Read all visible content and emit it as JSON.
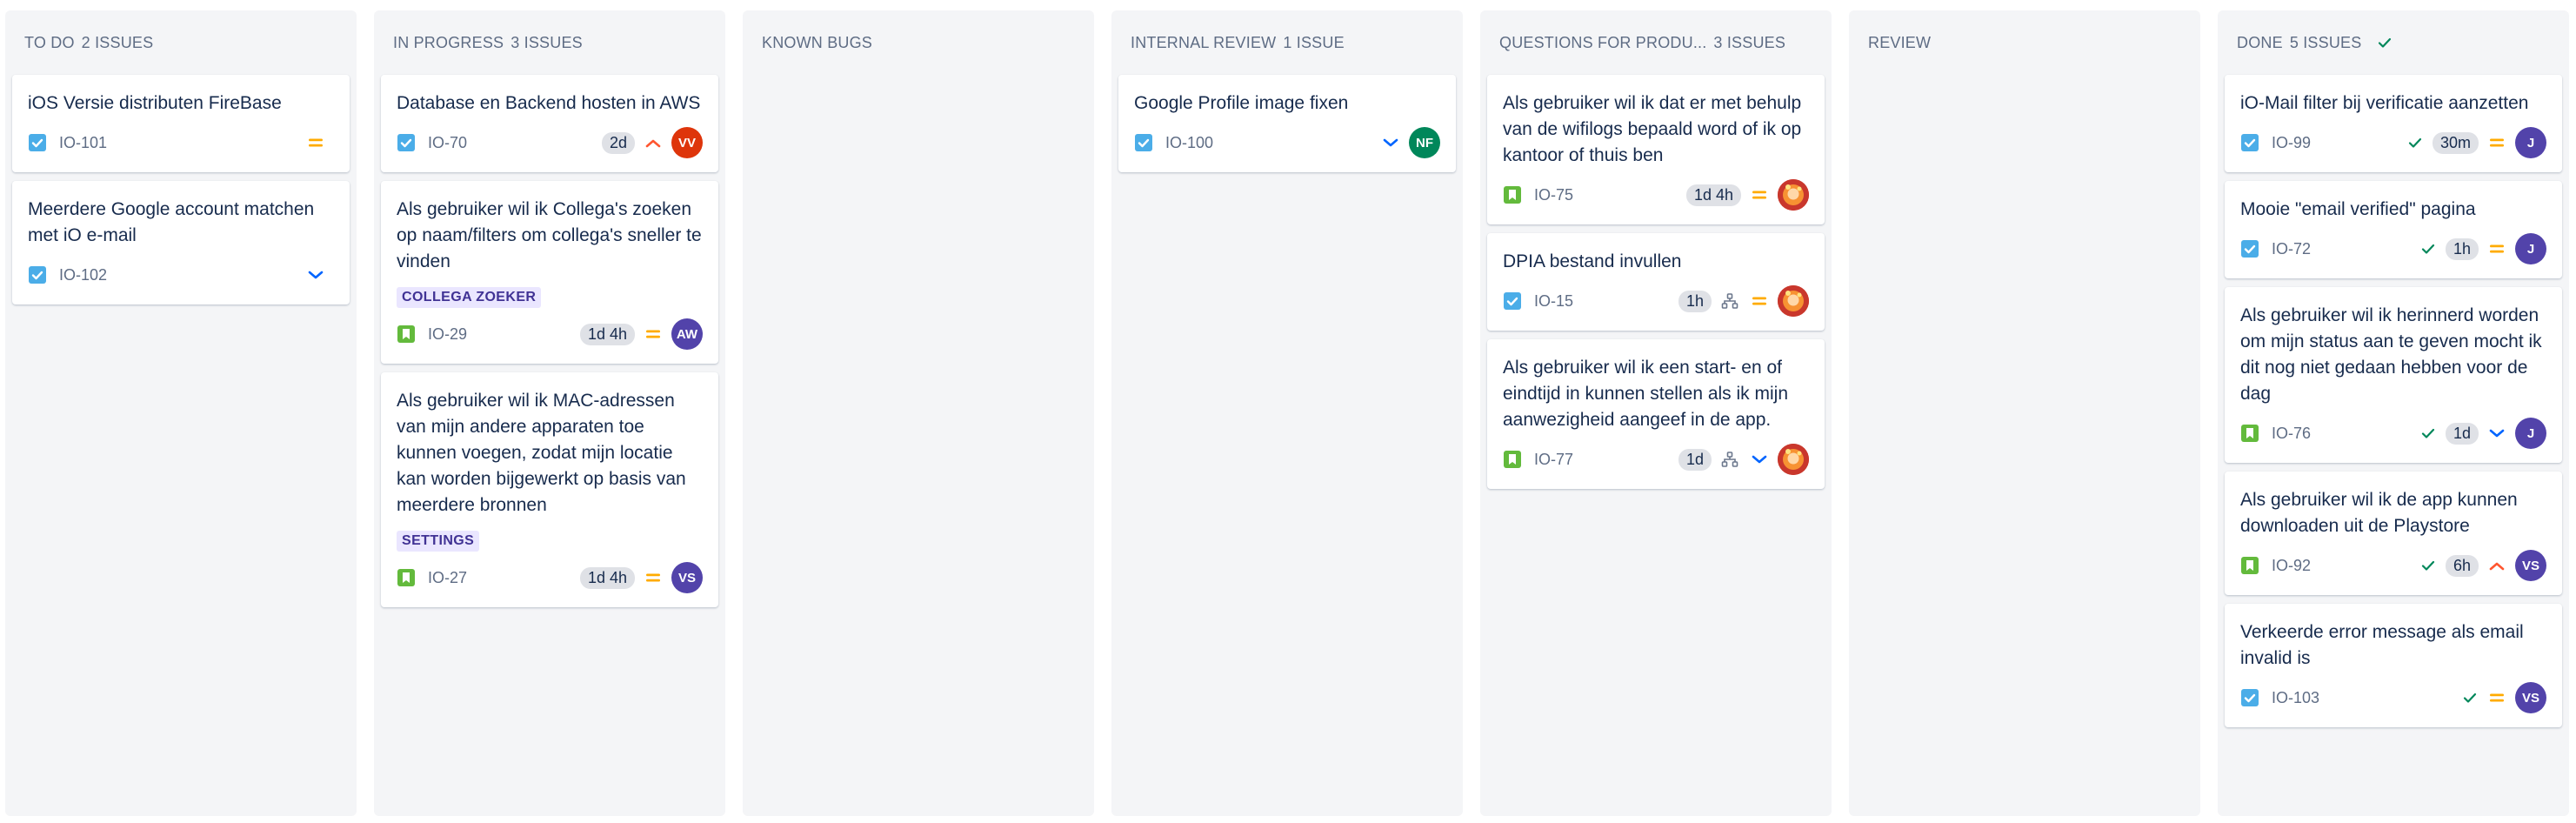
{
  "columns": [
    {
      "name": "TO DO",
      "count": "2 ISSUES",
      "done": false,
      "cards": [
        {
          "title": "iOS Versie distributen FireBase",
          "key": "IO-101",
          "type": "task",
          "priority": "medium"
        },
        {
          "title": "Meerdere Google account matchen met iO e-mail",
          "key": "IO-102",
          "type": "task",
          "priority": "low"
        }
      ]
    },
    {
      "name": "IN PROGRESS",
      "count": "3 ISSUES",
      "done": false,
      "cards": [
        {
          "title": "Database en Backend hosten in AWS",
          "key": "IO-70",
          "type": "task",
          "estimate": "2d",
          "priority": "high",
          "avatar": {
            "initials": "VV",
            "color": "#de350b"
          }
        },
        {
          "title": "Als gebruiker wil ik Collega's zoeken op naam/filters om collega's sneller te vinden",
          "label": "COLLEGA ZOEKER",
          "key": "IO-29",
          "type": "story",
          "estimate": "1d 4h",
          "priority": "medium",
          "avatar": {
            "initials": "AW",
            "color": "#5243aa"
          }
        },
        {
          "title": "Als gebruiker wil ik MAC-adressen van mijn andere apparaten toe kunnen voegen, zodat mijn locatie kan worden bijgewerkt op basis van meerdere bronnen",
          "label": "SETTINGS",
          "key": "IO-27",
          "type": "story",
          "estimate": "1d 4h",
          "priority": "medium",
          "avatar": {
            "initials": "VS",
            "color": "#5243aa"
          }
        }
      ]
    },
    {
      "name": "KNOWN BUGS",
      "count": "",
      "done": false,
      "cards": []
    },
    {
      "name": "INTERNAL REVIEW",
      "count": "1 ISSUE",
      "done": false,
      "cards": [
        {
          "title": "Google Profile image fixen",
          "key": "IO-100",
          "type": "task",
          "priority": "low",
          "avatar": {
            "initials": "NF",
            "color": "#00875a"
          }
        }
      ]
    },
    {
      "name": "QUESTIONS FOR PRODU...",
      "count": "3 ISSUES",
      "done": false,
      "cards": [
        {
          "title": "Als gebruiker wil ik dat er met behulp van de wifilogs bepaald word of ik op kantoor of thuis ben",
          "key": "IO-75",
          "type": "story",
          "estimate": "1d 4h",
          "priority": "medium",
          "avatar": {
            "initials": "",
            "color": "#c9372c",
            "photo": true
          }
        },
        {
          "title": "DPIA bestand invullen",
          "key": "IO-15",
          "type": "task",
          "estimate": "1h",
          "subtasks": true,
          "priority": "medium",
          "avatar": {
            "initials": "",
            "color": "#c9372c",
            "photo": true
          }
        },
        {
          "title": "Als gebruiker wil ik een start- en of eindtijd in kunnen stellen als ik mijn aanwezigheid aangeef in de app.",
          "key": "IO-77",
          "type": "story",
          "estimate": "1d",
          "subtasks": true,
          "priority": "low",
          "avatar": {
            "initials": "",
            "color": "#c9372c",
            "photo": true
          }
        }
      ]
    },
    {
      "name": "REVIEW",
      "count": "",
      "done": false,
      "cards": []
    },
    {
      "name": "DONE",
      "count": "5 ISSUES",
      "done": true,
      "cards": [
        {
          "title": "iO-Mail filter bij verificatie aanzetten",
          "key": "IO-99",
          "type": "task",
          "resolved": true,
          "estimate": "30m",
          "priority": "medium",
          "avatar": {
            "initials": "J",
            "color": "#5243aa"
          }
        },
        {
          "title": "Mooie \"email verified\" pagina",
          "key": "IO-72",
          "type": "task",
          "resolved": true,
          "estimate": "1h",
          "priority": "medium",
          "avatar": {
            "initials": "J",
            "color": "#5243aa"
          }
        },
        {
          "title": "Als gebruiker wil ik herinnerd worden om mijn status aan te geven mocht ik dit nog niet gedaan hebben voor de dag",
          "key": "IO-76",
          "type": "story",
          "resolved": true,
          "estimate": "1d",
          "priority": "low",
          "avatar": {
            "initials": "J",
            "color": "#5243aa"
          }
        },
        {
          "title": "Als gebruiker wil ik de app kunnen downloaden uit de Playstore",
          "key": "IO-92",
          "type": "story",
          "resolved": true,
          "estimate": "6h",
          "priority": "high",
          "avatar": {
            "initials": "VS",
            "color": "#5243aa"
          }
        },
        {
          "title": "Verkeerde error message als email invalid is",
          "key": "IO-103",
          "type": "task",
          "resolved": true,
          "priority": "medium",
          "avatar": {
            "initials": "VS",
            "color": "#5243aa"
          }
        }
      ]
    }
  ],
  "colors": {
    "task": "#4bade8",
    "story": "#63ba3c",
    "priority_medium": "#ffab00",
    "priority_high": "#ff5630",
    "priority_low": "#0065ff",
    "done_check": "#00875a"
  }
}
